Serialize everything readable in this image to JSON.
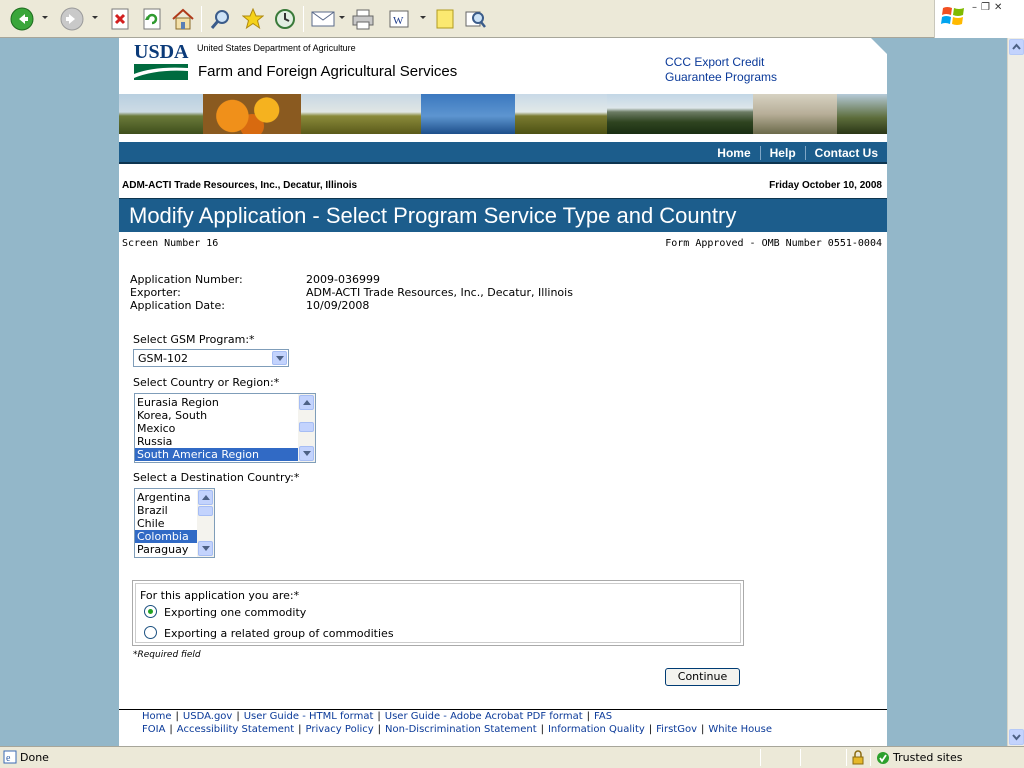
{
  "browser": {
    "toolbar_icons": [
      "back-icon",
      "forward-icon",
      "stop-icon",
      "refresh-icon",
      "home-icon",
      "search-icon",
      "favorites-icon",
      "history-icon",
      "mail-icon",
      "print-icon",
      "edit-icon",
      "discuss-icon",
      "research-icon"
    ],
    "status_left": "Done",
    "status_zone": "Trusted sites"
  },
  "header": {
    "logo_text": "USDA",
    "department": "United States Department of Agriculture",
    "agency": "Farm and Foreign Agricultural Services",
    "program_line1": "CCC Export Credit",
    "program_line2": "Guarantee Programs"
  },
  "nav": {
    "items": [
      {
        "label": "Home"
      },
      {
        "label": "Help"
      },
      {
        "label": "Contact Us"
      }
    ]
  },
  "page": {
    "organization": "ADM-ACTI Trade Resources, Inc., Decatur, Illinois",
    "date": "Friday October 10, 2008",
    "title": "Modify Application - Select Program Service Type and Country",
    "screen_number": "Screen Number 16",
    "omb": "Form Approved - OMB Number 0551-0004"
  },
  "application": {
    "number_label": "Application Number:",
    "number_value": "2009-036999",
    "exporter_label": "Exporter:",
    "exporter_value": "ADM-ACTI Trade Resources, Inc., Decatur, Illinois",
    "date_label": "Application Date:",
    "date_value": "10/09/2008"
  },
  "form": {
    "gsm_label": "Select GSM Program:*",
    "gsm_value": "GSM-102",
    "region_label": "Select Country or Region:*",
    "regions": [
      "Eurasia Region",
      "Korea, South",
      "Mexico",
      "Russia",
      "South America Region"
    ],
    "region_selected": "South America Region",
    "destination_label": "Select a Destination Country:*",
    "destinations": [
      "Argentina",
      "Brazil",
      "Chile",
      "Colombia",
      "Paraguay"
    ],
    "destination_selected": "Colombia",
    "type_legend": "For this application you are:*",
    "option1": "Exporting one commodity",
    "option2": "Exporting a related group of commodities",
    "option_selected": "Exporting one commodity",
    "required_note": "*Required field",
    "continue_label": "Continue"
  },
  "footer": {
    "row1": [
      "Home",
      "USDA.gov",
      "User Guide - HTML format",
      "User Guide - Adobe Acrobat PDF format",
      "FAS"
    ],
    "row2": [
      "FOIA",
      "Accessibility Statement",
      "Privacy Policy",
      "Non-Discrimination Statement",
      "Information Quality",
      "FirstGov",
      "White House"
    ]
  }
}
